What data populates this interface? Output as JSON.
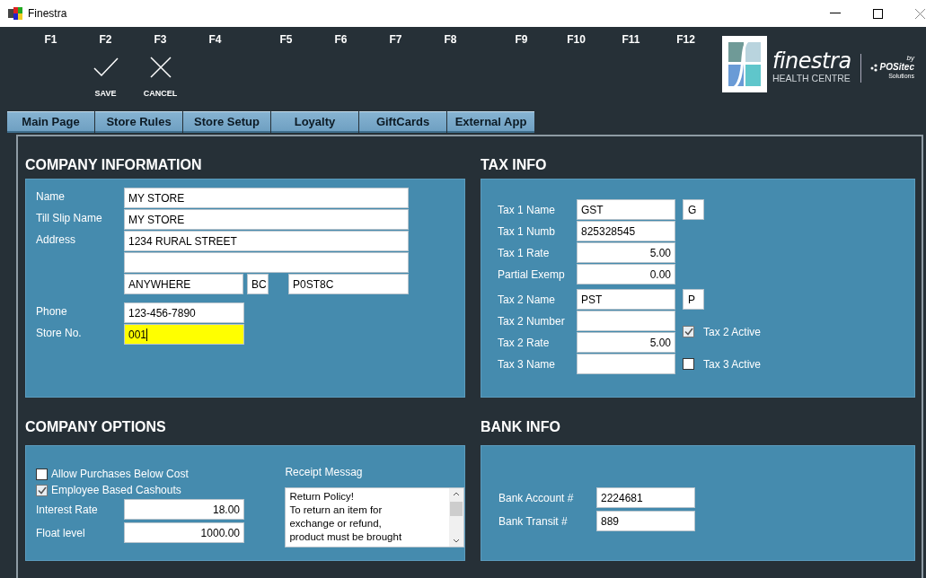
{
  "window": {
    "title": "Finestra"
  },
  "function_key_groups": [
    [
      {
        "key": "F1"
      },
      {
        "key": "F2",
        "kind": "save",
        "label": "SAVE"
      },
      {
        "key": "F3",
        "kind": "cancel",
        "label": "CANCEL"
      },
      {
        "key": "F4"
      }
    ],
    [
      {
        "key": "F5"
      },
      {
        "key": "F6"
      },
      {
        "key": "F7"
      },
      {
        "key": "F8"
      }
    ],
    [
      {
        "key": "F9"
      },
      {
        "key": "F10"
      },
      {
        "key": "F11"
      },
      {
        "key": "F12"
      }
    ]
  ],
  "logo": {
    "name": "finestra",
    "subtitle": "HEALTH CENTRE",
    "by": "by",
    "maker": "POSitec",
    "maker_sub": "Solutions"
  },
  "tabs": [
    {
      "label": "Main Page"
    },
    {
      "label": "Store Rules"
    },
    {
      "label": "Store Setup"
    },
    {
      "label": "Loyalty"
    },
    {
      "label": "GiftCards"
    },
    {
      "label": "External App"
    }
  ],
  "company_information": {
    "title": "COMPANY INFORMATION",
    "name": {
      "label": "Name",
      "value": "MY STORE"
    },
    "till_slip_name": {
      "label": "Till Slip Name",
      "value": "MY STORE"
    },
    "address": {
      "label": "Address",
      "line_1": "1234 RURAL STREET",
      "city": "ANYWHERE",
      "province": "BC",
      "postal_code": "P0ST8C"
    },
    "phone": {
      "label": "Phone",
      "value": "123-456-7890"
    },
    "store_no": {
      "label": "Store No.",
      "value": "001",
      "focused": true
    }
  },
  "tax_info": {
    "title": "TAX INFO",
    "groups": [
      [
        {
          "label": "Tax 1 Name",
          "value": "GST",
          "kind": "text",
          "code": "G"
        },
        {
          "label": "Tax 1 Numb",
          "value": "825328545",
          "kind": "text"
        },
        {
          "label": "Tax 1 Rate",
          "value": "5.00",
          "kind": "number"
        },
        {
          "label": "Partial Exemp",
          "value": "0.00",
          "kind": "number"
        }
      ],
      [
        {
          "label": "Tax 2 Name",
          "value": "PST",
          "kind": "text",
          "code": "P"
        },
        {
          "label": "Tax 2 Number",
          "kind": "text",
          "toggle": {
            "label": "Tax 2 Active",
            "checked": true
          }
        },
        {
          "label": "Tax 2 Rate",
          "value": "5.00",
          "kind": "number"
        },
        {
          "label": "Tax 3 Name",
          "kind": "text",
          "toggle": {
            "label": "Tax 3 Active",
            "checked": false
          }
        }
      ]
    ]
  },
  "company_options": {
    "title": "COMPANY OPTIONS",
    "checkboxes": [
      {
        "label": "Allow Purchases Below Cost",
        "checked": false
      },
      {
        "label": "Employee Based Cashouts",
        "checked": true
      }
    ],
    "fields": [
      {
        "label": "Interest Rate",
        "value": "18.00"
      },
      {
        "label": "Float level",
        "value": "1000.00"
      }
    ],
    "receipt_message": {
      "label": "Receipt Messag",
      "value": "Return Policy!\nTo return an item for\nexchange or refund,\nproduct must be brought"
    }
  },
  "bank_info": {
    "title": "BANK INFO",
    "fields": [
      {
        "label": "Bank Account #",
        "value": "2224681"
      },
      {
        "label": "Bank Transit #",
        "value": "889"
      }
    ]
  }
}
